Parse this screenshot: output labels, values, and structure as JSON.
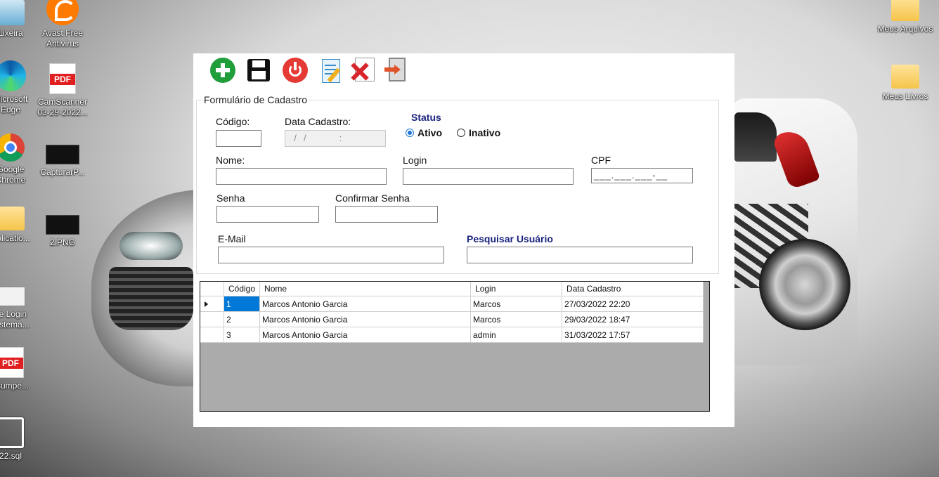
{
  "desktop": {
    "icons": [
      {
        "label": "Lixeira",
        "icon": "recycle-bin-icon"
      },
      {
        "label": "Avast Free Antivirus",
        "icon": "avast-icon"
      },
      {
        "label": "Meus Arquivos",
        "icon": "folder-icon"
      },
      {
        "label": "Microsoft Edge",
        "icon": "edge-icon"
      },
      {
        "label": "CamScanner 03-29-2022...",
        "icon": "pdf-icon"
      },
      {
        "label": "Meus Livros",
        "icon": "folder-icon"
      },
      {
        "label": "Google Chrome",
        "icon": "chrome-icon"
      },
      {
        "label": "CapturarP...",
        "icon": "image-icon"
      },
      {
        "label": "Aplicatio...",
        "icon": "folder-icon"
      },
      {
        "label": "2.PNG",
        "icon": "image-icon"
      },
      {
        "label": "de Login Sistema...",
        "icon": "login-app-icon"
      },
      {
        "label": "csumpe...",
        "icon": "pdf-icon"
      },
      {
        "label": "22.sql",
        "icon": "sql-file-icon"
      }
    ]
  },
  "toolbar": {
    "buttons": [
      {
        "name": "add-button",
        "icon": "plus-circle-icon",
        "color": "#1f9e3a"
      },
      {
        "name": "save-button",
        "icon": "floppy-disk-icon",
        "color": "#111111"
      },
      {
        "name": "power-button",
        "icon": "power-icon",
        "color": "#e53935"
      },
      {
        "name": "edit-button",
        "icon": "edit-document-icon",
        "color": "#3a8cc8"
      },
      {
        "name": "delete-button",
        "icon": "delete-document-icon",
        "color": "#d6262b"
      },
      {
        "name": "exit-button",
        "icon": "exit-door-icon",
        "color": "#e0522a"
      }
    ]
  },
  "form": {
    "group_title": "Formulário de Cadastro",
    "codigo_label": "Código:",
    "codigo_value": "",
    "data_cadastro_label": "Data Cadastro:",
    "data_cadastro_value": "  /  /          :",
    "status_label": "Status",
    "status_options": [
      {
        "label": "Ativo",
        "selected": true
      },
      {
        "label": "Inativo",
        "selected": false
      }
    ],
    "nome_label": "Nome:",
    "nome_value": "",
    "login_label": "Login",
    "login_value": "",
    "cpf_label": "CPF",
    "cpf_value": "___.___.___-__",
    "senha_label": "Senha",
    "senha_value": "",
    "confirmar_senha_label": "Confirmar Senha",
    "confirmar_senha_value": "",
    "email_label": "E-Mail",
    "email_value": "",
    "pesquisar_label": "Pesquisar Usuário",
    "pesquisar_value": "",
    "accent_color": "#1a237e",
    "radio_color": "#1e74d6"
  },
  "grid": {
    "columns": [
      "Código",
      "Nome",
      "Login",
      "Data Cadastro"
    ],
    "rows": [
      {
        "codigo": "1",
        "nome": "Marcos Antonio Garcia",
        "login": "Marcos",
        "data": "27/03/2022 22:20",
        "selected": true
      },
      {
        "codigo": "2",
        "nome": "Marcos Antonio Garcia",
        "login": "Marcos",
        "data": "29/03/2022 18:47",
        "selected": false
      },
      {
        "codigo": "3",
        "nome": "Marcos Antonio Garcia",
        "login": "admin",
        "data": "31/03/2022 17:57",
        "selected": false
      }
    ],
    "selection_color": "#0078d7"
  }
}
